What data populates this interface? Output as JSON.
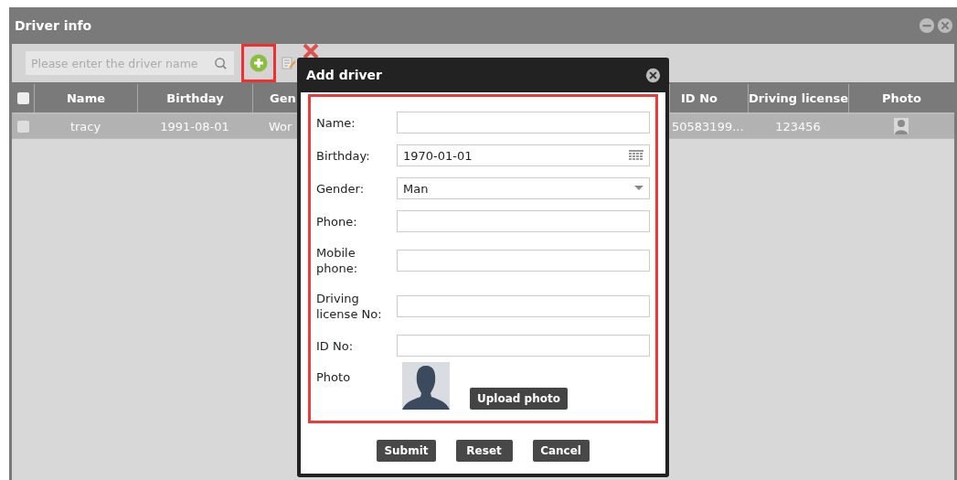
{
  "window": {
    "title": "Driver info"
  },
  "toolbar": {
    "search": {
      "placeholder": "Please enter the driver name"
    },
    "add_highlighted": true
  },
  "table": {
    "all_checked": false,
    "columns": [
      {
        "label": "Name"
      },
      {
        "label": "Birthday"
      },
      {
        "label": "Gen"
      },
      {
        "label": "ID No"
      },
      {
        "label": "Driving license"
      },
      {
        "label": "Photo"
      }
    ],
    "rows": [
      {
        "checked": false,
        "cells": [
          "tracy",
          "1991-08-01",
          "Wor",
          "50583199...",
          "123456"
        ]
      }
    ]
  },
  "dialog": {
    "title": "Add driver",
    "fields": [
      {
        "label": "Name:",
        "kind": "text"
      },
      {
        "label": "Birthday:",
        "kind": "date",
        "value": "1970-01-01"
      },
      {
        "label": "Gender:",
        "kind": "select",
        "value": "Man"
      },
      {
        "label": "Phone:",
        "kind": "text"
      },
      {
        "label": "Mobile phone:",
        "kind": "text"
      },
      {
        "label": "Driving license No:",
        "kind": "text"
      },
      {
        "label": "ID No:",
        "kind": "text"
      },
      {
        "label": "Photo",
        "kind": "photo",
        "button": "Upload photo"
      }
    ],
    "buttons": [
      "Submit",
      "Reset",
      "Cancel"
    ]
  }
}
